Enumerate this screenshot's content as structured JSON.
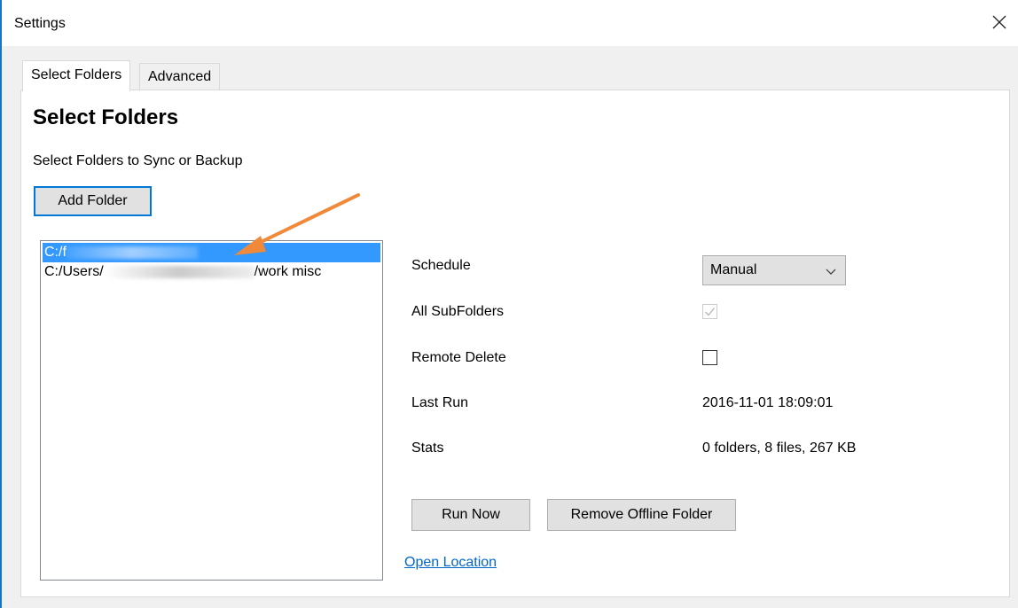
{
  "window": {
    "title": "Settings",
    "close_icon": "close-icon"
  },
  "tabs": [
    {
      "label": "Select Folders",
      "active": true
    },
    {
      "label": "Advanced",
      "active": false
    }
  ],
  "page": {
    "title": "Select Folders",
    "subtitle": "Select Folders to Sync or Backup",
    "add_folder_label": "Add Folder"
  },
  "folders": [
    {
      "prefix": "C:/f",
      "suffix": "",
      "selected": true
    },
    {
      "prefix": "C:/Users/",
      "suffix": "/work misc",
      "selected": false
    }
  ],
  "properties": {
    "schedule_label": "Schedule",
    "schedule_value": "Manual",
    "subfolders_label": "All SubFolders",
    "subfolders_checked": true,
    "remote_delete_label": "Remote Delete",
    "remote_delete_checked": false,
    "last_run_label": "Last Run",
    "last_run_value": "2016-11-01 18:09:01",
    "stats_label": "Stats",
    "stats_value": "0 folders, 8 files, 267 KB"
  },
  "actions": {
    "run_now_label": "Run Now",
    "remove_offline_label": "Remove Offline Folder",
    "open_location_label": "Open Location"
  },
  "colors": {
    "selection": "#3399ff",
    "focus_border": "#0078d7",
    "link": "#0066cc",
    "annotation_arrow": "#f08a3a"
  }
}
